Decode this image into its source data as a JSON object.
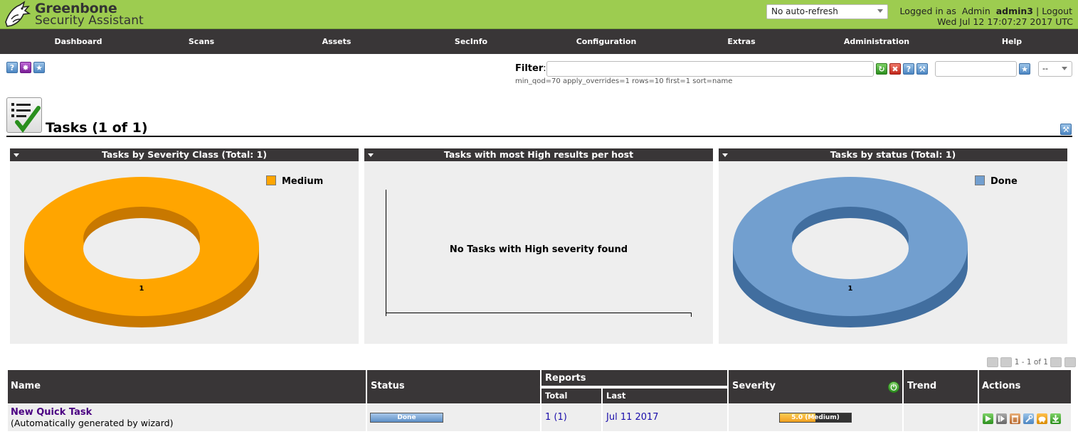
{
  "header": {
    "brand_line1": "Greenbone",
    "brand_line2": "Security Assistant",
    "refresh_value": "No auto-refresh",
    "logged_in_prefix": "Logged in as",
    "role": "Admin",
    "username": "admin3",
    "separator": "|",
    "logout": "Logout",
    "datetime": "Wed Jul 12 17:07:27 2017 UTC"
  },
  "nav": [
    "Dashboard",
    "Scans",
    "Assets",
    "SecInfo",
    "Configuration",
    "Extras",
    "Administration",
    "Help"
  ],
  "toolbar": {
    "help_icon": "?",
    "wizard_icon": "✸",
    "new_icon": "★"
  },
  "filter": {
    "label": "Filter",
    "colon": ":",
    "value": "",
    "text": "min_qod=70 apply_overrides=1 rows=10 first=1 sort=name",
    "select_value": "--"
  },
  "page": {
    "title": "Tasks (1 of 1)"
  },
  "charts": {
    "severity": {
      "title": "Tasks by Severity Class (Total: 1)",
      "legend": "Medium",
      "color_top": "#ffa500",
      "color_side": "#c87800",
      "label": "1"
    },
    "high_results": {
      "title": "Tasks with most High results per host",
      "message": "No Tasks with High severity found"
    },
    "status": {
      "title": "Tasks by status (Total: 1)",
      "legend": "Done",
      "color_top": "#729fcf",
      "color_side": "#416e9f",
      "label": "1"
    }
  },
  "chart_data": [
    {
      "type": "pie",
      "title": "Tasks by Severity Class (Total: 1)",
      "categories": [
        "Medium"
      ],
      "values": [
        1
      ]
    },
    {
      "type": "bar",
      "title": "Tasks with most High results per host",
      "categories": [],
      "values": []
    },
    {
      "type": "pie",
      "title": "Tasks by status (Total: 1)",
      "categories": [
        "Done"
      ],
      "values": [
        1
      ]
    }
  ],
  "pager": {
    "text": "1 - 1 of 1"
  },
  "table": {
    "headers": {
      "name": "Name",
      "status": "Status",
      "reports": "Reports",
      "total": "Total",
      "last": "Last",
      "severity": "Severity",
      "trend": "Trend",
      "actions": "Actions"
    },
    "rows": [
      {
        "name": "New Quick Task",
        "comment": "(Automatically generated by wizard)",
        "status": "Done",
        "reports_total": "1 (1)",
        "reports_last": "Jul 11 2017",
        "severity_text": "5.0 (Medium)",
        "severity_fraction": 0.5,
        "trend": ""
      }
    ]
  }
}
